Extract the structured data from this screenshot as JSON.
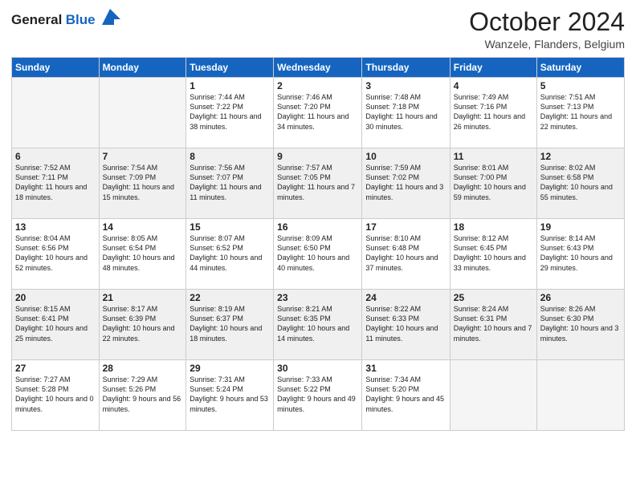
{
  "header": {
    "logo_general": "General",
    "logo_blue": "Blue",
    "month_year": "October 2024",
    "location": "Wanzele, Flanders, Belgium"
  },
  "days_of_week": [
    "Sunday",
    "Monday",
    "Tuesday",
    "Wednesday",
    "Thursday",
    "Friday",
    "Saturday"
  ],
  "weeks": [
    [
      {
        "day": "",
        "empty": true
      },
      {
        "day": "",
        "empty": true
      },
      {
        "day": "1",
        "sunrise": "7:44 AM",
        "sunset": "7:22 PM",
        "daylight": "11 hours and 38 minutes."
      },
      {
        "day": "2",
        "sunrise": "7:46 AM",
        "sunset": "7:20 PM",
        "daylight": "11 hours and 34 minutes."
      },
      {
        "day": "3",
        "sunrise": "7:48 AM",
        "sunset": "7:18 PM",
        "daylight": "11 hours and 30 minutes."
      },
      {
        "day": "4",
        "sunrise": "7:49 AM",
        "sunset": "7:16 PM",
        "daylight": "11 hours and 26 minutes."
      },
      {
        "day": "5",
        "sunrise": "7:51 AM",
        "sunset": "7:13 PM",
        "daylight": "11 hours and 22 minutes."
      }
    ],
    [
      {
        "day": "6",
        "sunrise": "7:52 AM",
        "sunset": "7:11 PM",
        "daylight": "11 hours and 18 minutes."
      },
      {
        "day": "7",
        "sunrise": "7:54 AM",
        "sunset": "7:09 PM",
        "daylight": "11 hours and 15 minutes."
      },
      {
        "day": "8",
        "sunrise": "7:56 AM",
        "sunset": "7:07 PM",
        "daylight": "11 hours and 11 minutes."
      },
      {
        "day": "9",
        "sunrise": "7:57 AM",
        "sunset": "7:05 PM",
        "daylight": "11 hours and 7 minutes."
      },
      {
        "day": "10",
        "sunrise": "7:59 AM",
        "sunset": "7:02 PM",
        "daylight": "11 hours and 3 minutes."
      },
      {
        "day": "11",
        "sunrise": "8:01 AM",
        "sunset": "7:00 PM",
        "daylight": "10 hours and 59 minutes."
      },
      {
        "day": "12",
        "sunrise": "8:02 AM",
        "sunset": "6:58 PM",
        "daylight": "10 hours and 55 minutes."
      }
    ],
    [
      {
        "day": "13",
        "sunrise": "8:04 AM",
        "sunset": "6:56 PM",
        "daylight": "10 hours and 52 minutes."
      },
      {
        "day": "14",
        "sunrise": "8:05 AM",
        "sunset": "6:54 PM",
        "daylight": "10 hours and 48 minutes."
      },
      {
        "day": "15",
        "sunrise": "8:07 AM",
        "sunset": "6:52 PM",
        "daylight": "10 hours and 44 minutes."
      },
      {
        "day": "16",
        "sunrise": "8:09 AM",
        "sunset": "6:50 PM",
        "daylight": "10 hours and 40 minutes."
      },
      {
        "day": "17",
        "sunrise": "8:10 AM",
        "sunset": "6:48 PM",
        "daylight": "10 hours and 37 minutes."
      },
      {
        "day": "18",
        "sunrise": "8:12 AM",
        "sunset": "6:45 PM",
        "daylight": "10 hours and 33 minutes."
      },
      {
        "day": "19",
        "sunrise": "8:14 AM",
        "sunset": "6:43 PM",
        "daylight": "10 hours and 29 minutes."
      }
    ],
    [
      {
        "day": "20",
        "sunrise": "8:15 AM",
        "sunset": "6:41 PM",
        "daylight": "10 hours and 25 minutes."
      },
      {
        "day": "21",
        "sunrise": "8:17 AM",
        "sunset": "6:39 PM",
        "daylight": "10 hours and 22 minutes."
      },
      {
        "day": "22",
        "sunrise": "8:19 AM",
        "sunset": "6:37 PM",
        "daylight": "10 hours and 18 minutes."
      },
      {
        "day": "23",
        "sunrise": "8:21 AM",
        "sunset": "6:35 PM",
        "daylight": "10 hours and 14 minutes."
      },
      {
        "day": "24",
        "sunrise": "8:22 AM",
        "sunset": "6:33 PM",
        "daylight": "10 hours and 11 minutes."
      },
      {
        "day": "25",
        "sunrise": "8:24 AM",
        "sunset": "6:31 PM",
        "daylight": "10 hours and 7 minutes."
      },
      {
        "day": "26",
        "sunrise": "8:26 AM",
        "sunset": "6:30 PM",
        "daylight": "10 hours and 3 minutes."
      }
    ],
    [
      {
        "day": "27",
        "sunrise": "7:27 AM",
        "sunset": "5:28 PM",
        "daylight": "10 hours and 0 minutes."
      },
      {
        "day": "28",
        "sunrise": "7:29 AM",
        "sunset": "5:26 PM",
        "daylight": "9 hours and 56 minutes."
      },
      {
        "day": "29",
        "sunrise": "7:31 AM",
        "sunset": "5:24 PM",
        "daylight": "9 hours and 53 minutes."
      },
      {
        "day": "30",
        "sunrise": "7:33 AM",
        "sunset": "5:22 PM",
        "daylight": "9 hours and 49 minutes."
      },
      {
        "day": "31",
        "sunrise": "7:34 AM",
        "sunset": "5:20 PM",
        "daylight": "9 hours and 45 minutes."
      },
      {
        "day": "",
        "empty": true
      },
      {
        "day": "",
        "empty": true
      }
    ]
  ]
}
